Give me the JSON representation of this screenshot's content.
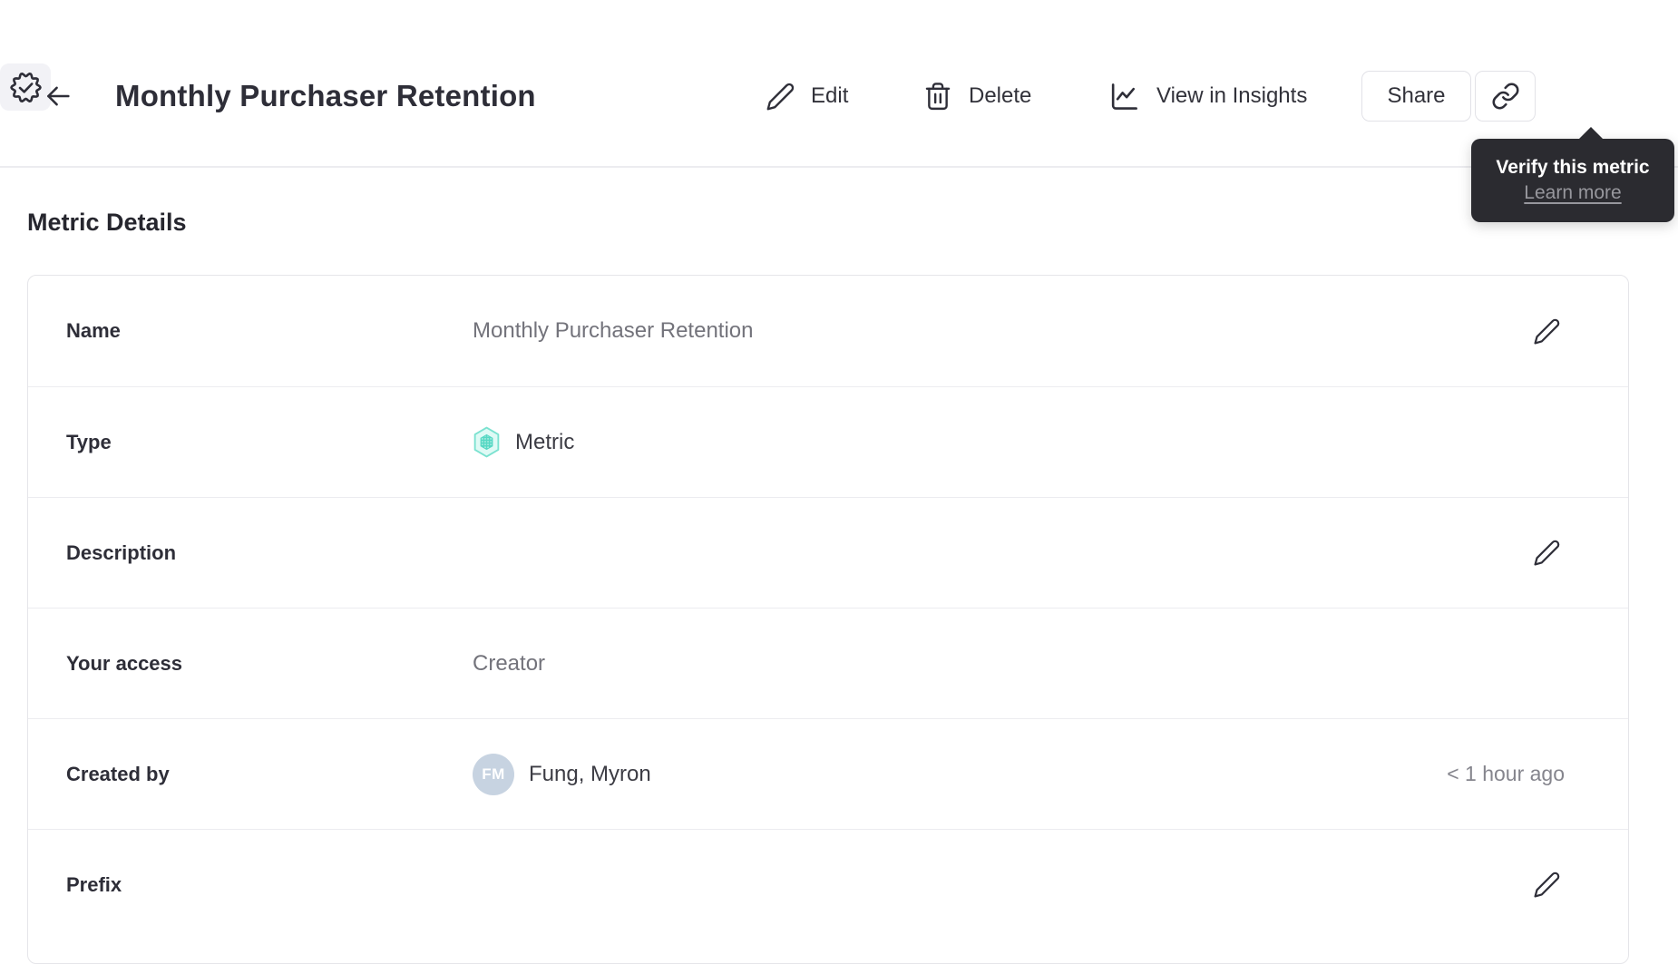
{
  "header": {
    "title": "Monthly Purchaser Retention",
    "toolbar": {
      "edit_label": "Edit",
      "delete_label": "Delete",
      "insights_label": "View in Insights",
      "share_label": "Share"
    }
  },
  "tooltip": {
    "title": "Verify this metric",
    "link_label": "Learn more"
  },
  "section_title": "Metric Details",
  "details": {
    "rows": [
      {
        "label": "Name",
        "value": "Monthly Purchaser Retention",
        "editable": true
      },
      {
        "label": "Type",
        "value": "Metric"
      },
      {
        "label": "Description",
        "value": "",
        "editable": true
      },
      {
        "label": "Your access",
        "value": "Creator"
      },
      {
        "label": "Created by",
        "value": "Fung, Myron",
        "avatar_initials": "FM",
        "timestamp": "< 1 hour ago"
      },
      {
        "label": "Prefix",
        "value": "",
        "editable": true
      }
    ]
  },
  "icons": {
    "back": "arrow-left-icon",
    "edit": "pencil-icon",
    "delete": "trash-icon",
    "insights": "line-chart-icon",
    "share_link": "link-icon",
    "verify": "verified-badge-icon",
    "metric_type": "hexagon-metric-icon",
    "row_edit": "pencil-icon"
  },
  "colors": {
    "ink": "#2e2e38",
    "gray-val": "#73737b",
    "tooltip-bg": "#2b2b30",
    "hex-border": "#7be2d0",
    "hex-fill": "#dffaf5",
    "hex-inner": "#56d8c4",
    "avatar-bg": "#c7d3e1",
    "badge-btn-bg": "#f2f2f6"
  }
}
